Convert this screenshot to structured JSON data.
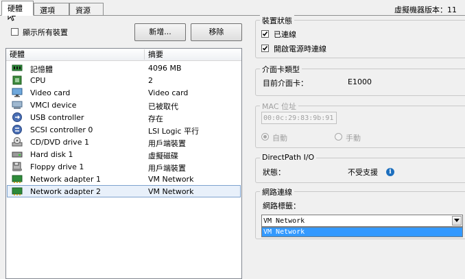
{
  "tabs": [
    {
      "label": "硬體",
      "active": true
    },
    {
      "label": "選項",
      "active": false
    },
    {
      "label": "資源",
      "active": false
    }
  ],
  "vm_version": "虛擬機器版本：11",
  "left": {
    "show_all_label": "顯示所有裝置",
    "add_button": "新增...",
    "remove_button": "移除",
    "columns": {
      "hardware": "硬體",
      "summary": "摘要"
    },
    "devices": [
      {
        "name": "記憶體",
        "summary": "4096 MB",
        "icon": "memory-icon"
      },
      {
        "name": "CPU",
        "summary": "2",
        "icon": "cpu-icon"
      },
      {
        "name": "Video card",
        "summary": "Video card",
        "icon": "monitor-icon"
      },
      {
        "name": "VMCI device",
        "summary": "已被取代",
        "icon": "vmci-device-icon"
      },
      {
        "name": "USB controller",
        "summary": "存在",
        "icon": "usb-icon"
      },
      {
        "name": "SCSI controller 0",
        "summary": "LSI Logic 平行",
        "icon": "scsi-icon"
      },
      {
        "name": "CD/DVD drive 1",
        "summary": "用戶端裝置",
        "icon": "cd-dvd-icon"
      },
      {
        "name": "Hard disk 1",
        "summary": "虛擬磁碟",
        "icon": "hard-disk-icon"
      },
      {
        "name": "Floppy drive 1",
        "summary": "用戶端裝置",
        "icon": "floppy-icon"
      },
      {
        "name": "Network adapter 1",
        "summary": "VM Network",
        "icon": "network-adapter-icon"
      },
      {
        "name": "Network adapter 2",
        "summary": "VM Network",
        "icon": "network-adapter-icon",
        "selected": true
      }
    ]
  },
  "device_status": {
    "title": "裝置狀態",
    "connected": {
      "label": "已連線",
      "checked": true
    },
    "connect_at_power_on": {
      "label": "開啟電源時連線",
      "checked": true
    }
  },
  "adapter_type": {
    "title": "介面卡類型",
    "current_label": "目前介面卡：",
    "current_value": "E1000"
  },
  "mac": {
    "title": "MAC 位址",
    "value": "00:0c:29:83:9b:91",
    "auto_label": "自動",
    "manual_label": "手動"
  },
  "directpath": {
    "title": "DirectPath I/O",
    "status_label": "狀態：",
    "status_value": "不受支援"
  },
  "network": {
    "title": "網路連線",
    "label_caption": "網路標籤：",
    "selected": "VM Network",
    "options": [
      "VM Network"
    ]
  },
  "colors": {
    "selection_blue": "#3399ff",
    "info_blue": "#1d6fbe"
  }
}
